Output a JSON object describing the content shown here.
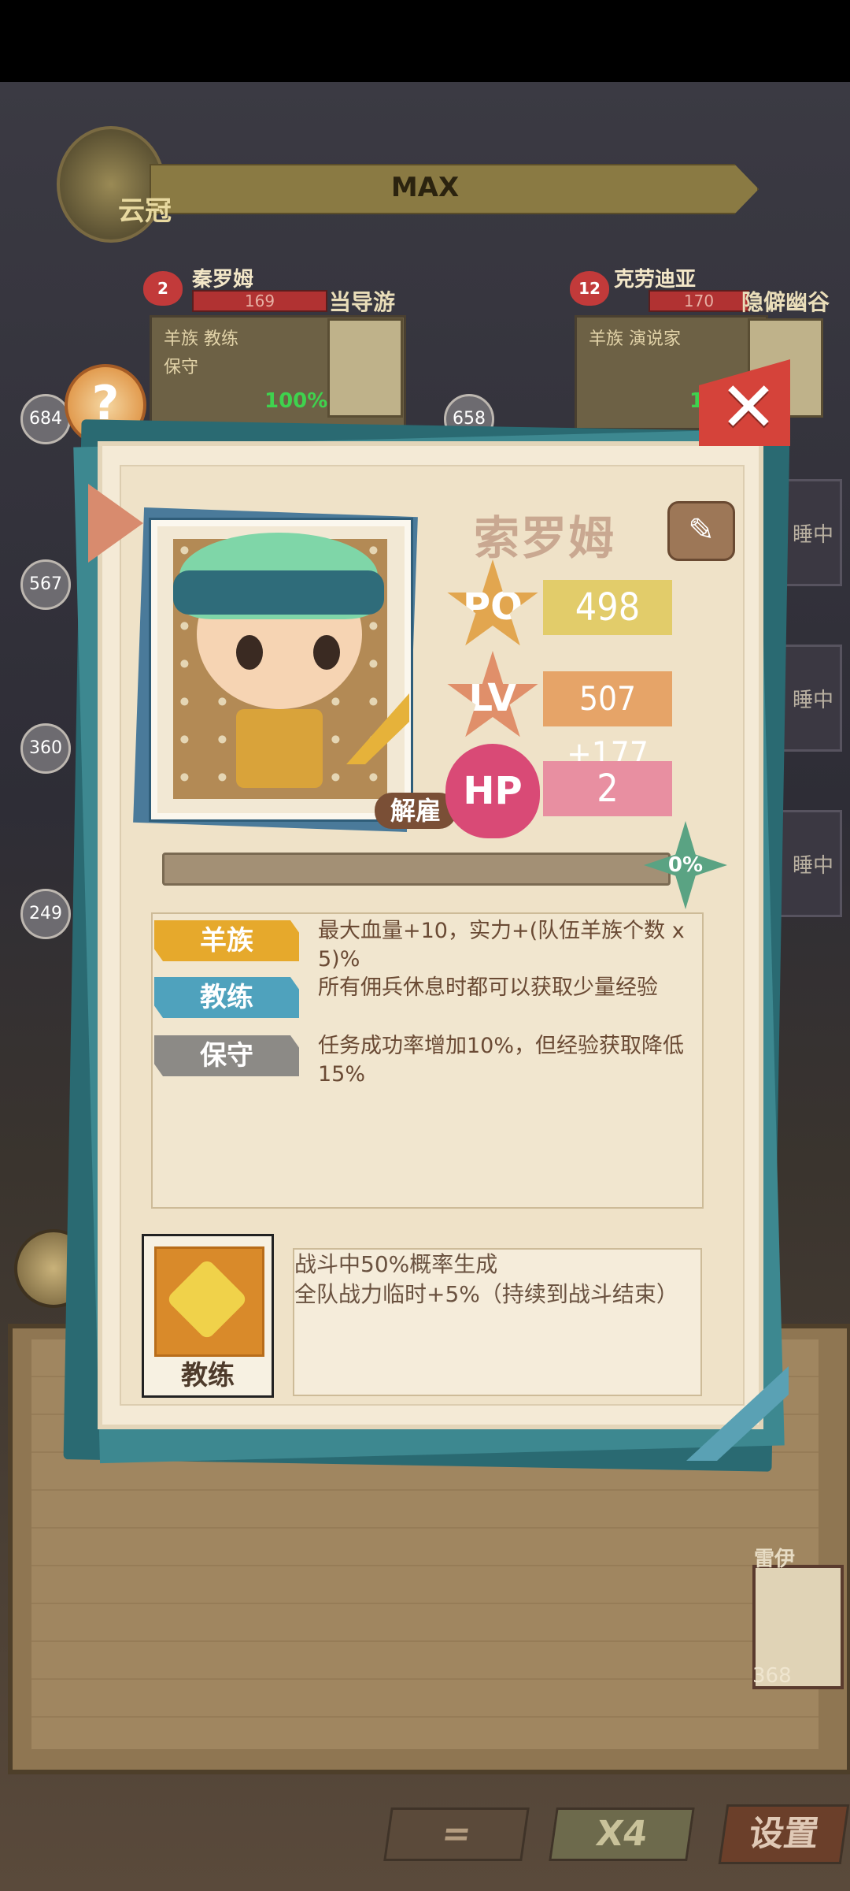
{
  "background": {
    "rank": {
      "label": "云冠"
    },
    "level_bar": {
      "text": "MAX"
    },
    "mercenaries": [
      {
        "name": "秦罗姆",
        "hearts": "2",
        "hp": "169",
        "location": "当导游",
        "tags": "羊族  教练",
        "tags2": "保守",
        "percent": "100%",
        "power": "684"
      },
      {
        "name": "克劳迪亚",
        "hearts": "12",
        "hp": "170",
        "location": "隐僻幽谷",
        "tags": "羊族  演说家",
        "tags2": "",
        "percent": "1",
        "power": "658"
      }
    ],
    "side_powers": [
      "567",
      "360",
      "249"
    ],
    "side_tabs": [
      "睡中",
      "睡中",
      "睡中"
    ],
    "lower_card": {
      "name": "雷伊",
      "power": "368"
    },
    "bottom_buttons": {
      "equals": "=",
      "speed": "X4",
      "settings": "设置"
    }
  },
  "modal": {
    "name": "索罗姆",
    "dismiss_label": "解雇",
    "stats": {
      "po": {
        "badge": "PO",
        "value": "498"
      },
      "lv": {
        "badge": "LV",
        "value": "507 +177"
      },
      "hp": {
        "badge": "HP",
        "value": "2"
      }
    },
    "progress": {
      "value": 0,
      "label": "0%"
    },
    "traits": [
      {
        "tag": "羊族",
        "color": "#e6a92c",
        "desc": "最大血量+10，实力+(队伍羊族个数 x 5)%"
      },
      {
        "tag": "教练",
        "color": "#4fa2bd",
        "desc": "所有佣兵休息时都可以获取少量经验"
      },
      {
        "tag": "保守",
        "color": "#8c8a86",
        "desc": "任务成功率增加10%，但经验获取降低15%"
      }
    ],
    "skill": {
      "label": "教练",
      "lines": [
        "战斗中50%概率生成",
        "全队战力临时+5%（持续到战斗结束）"
      ]
    }
  },
  "colors": {
    "po_bar": "#e2cc6a",
    "lv_bar": "#e6a468",
    "hp_bar": "#e88fa1",
    "po_badge": "#e2a64f",
    "lv_badge": "#e08f6a",
    "hp_badge": "#d94a76"
  }
}
